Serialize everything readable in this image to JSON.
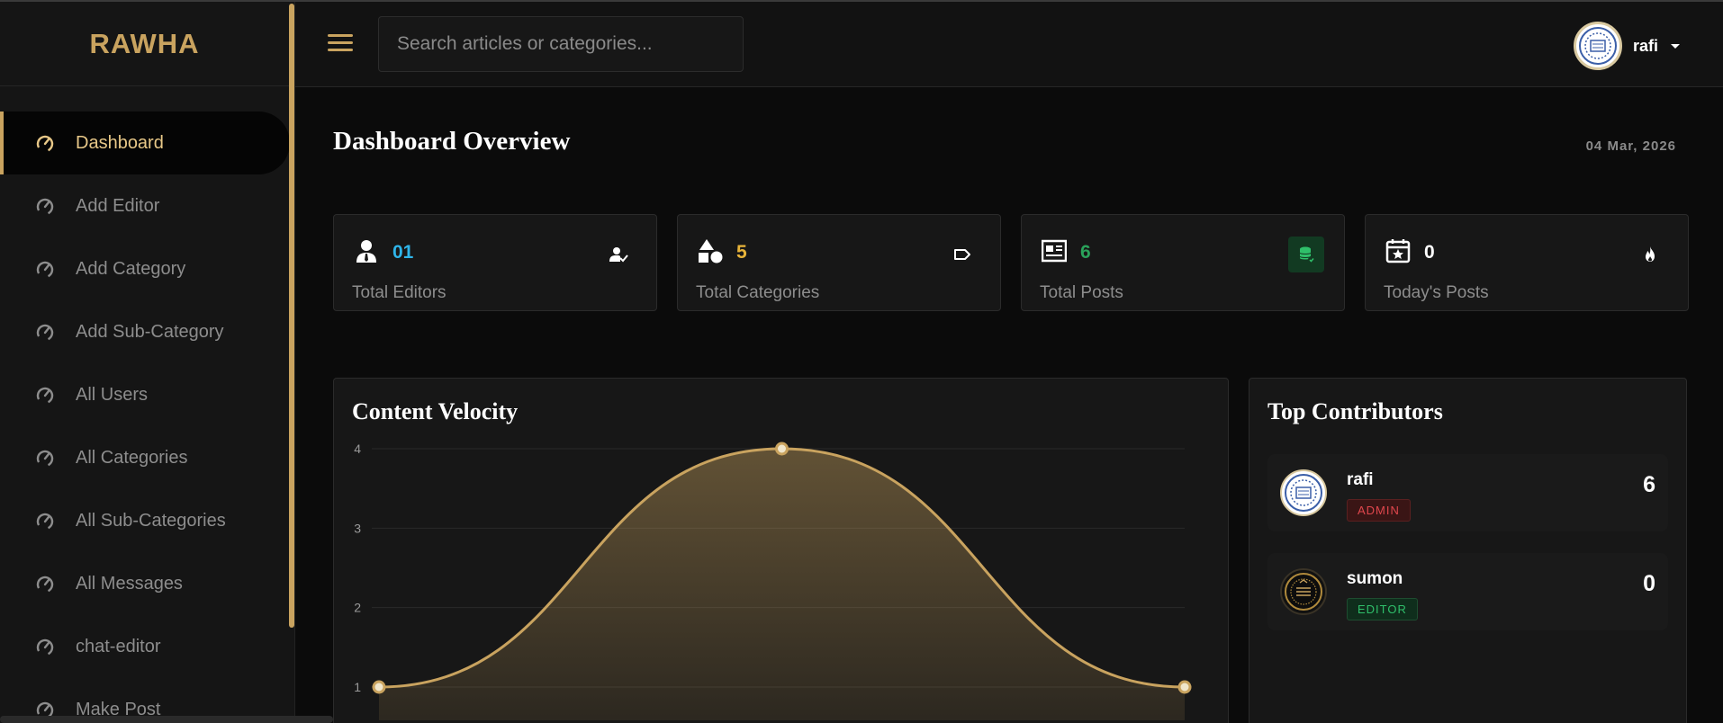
{
  "app": {
    "brand": "RAWHA"
  },
  "sidebar": {
    "items": [
      {
        "label": "Dashboard",
        "active": true
      },
      {
        "label": "Add Editor"
      },
      {
        "label": "Add Category"
      },
      {
        "label": "Add Sub-Category"
      },
      {
        "label": "All Users"
      },
      {
        "label": "All Categories"
      },
      {
        "label": "All Sub-Categories"
      },
      {
        "label": "All Messages"
      },
      {
        "label": "chat-editor"
      },
      {
        "label": "Make Post"
      }
    ]
  },
  "header": {
    "search_placeholder": "Search articles or categories...",
    "user_name": "rafi"
  },
  "main": {
    "title": "Dashboard Overview",
    "date": "04 Mar, 2026",
    "stats": [
      {
        "value": "01",
        "label": "Total Editors",
        "color": "#2fb5ea",
        "icon": "user-tie-icon",
        "trail_icon": "user-check-icon"
      },
      {
        "value": "5",
        "label": "Total Categories",
        "color": "#e8b43a",
        "icon": "shapes-icon",
        "trail_icon": "tag-icon"
      },
      {
        "value": "6",
        "label": "Total Posts",
        "color": "#2aa25a",
        "icon": "newspaper-icon",
        "trail_icon": "database-check-icon"
      },
      {
        "value": "0",
        "label": "Today's Posts",
        "color": "#ffffff",
        "icon": "calendar-star-icon",
        "trail_icon": "fire-icon"
      }
    ],
    "velocity": {
      "title": "Content Velocity"
    },
    "contributors": {
      "title": "Top Contributors",
      "list": [
        {
          "name": "rafi",
          "role": "ADMIN",
          "count": "6"
        },
        {
          "name": "sumon",
          "role": "EDITOR",
          "count": "0"
        }
      ]
    }
  },
  "chart_data": {
    "type": "area",
    "title": "Content Velocity",
    "x": [
      "",
      "",
      ""
    ],
    "series": [
      {
        "values": [
          1,
          4,
          1
        ]
      }
    ],
    "ylim": [
      1,
      4
    ],
    "yticks": [
      1,
      2,
      3,
      4
    ],
    "grid": true,
    "color": "#c9a35f"
  }
}
